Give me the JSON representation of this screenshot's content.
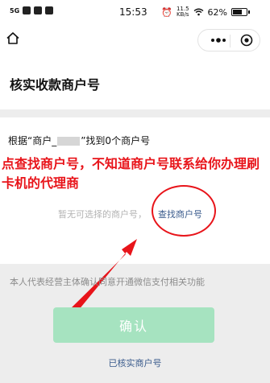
{
  "status_bar": {
    "signal": "5G",
    "time": "15:53",
    "network_speed_top": "11.5",
    "network_speed_unit": "KB/s",
    "battery": "62%",
    "battery_level": 0.62
  },
  "page": {
    "title": "核实收款商户号"
  },
  "card": {
    "result_prefix": "根据“商户_",
    "result_suffix": "”找到0个商户号",
    "annotation": "点查找商户号，不知道商户号联系给你办理刷卡机的代理商",
    "empty_tip": "暂无可选择的商户号，",
    "find_link": "查找商户号"
  },
  "agreement": "本人代表经营主体确认同意开通微信支付相关功能",
  "confirm_button": "确认",
  "verified_link": "已核实商户号",
  "colors": {
    "annotation_red": "#e8141a",
    "link_blue": "#3a5b8c",
    "button_green": "#a6e3c0"
  }
}
